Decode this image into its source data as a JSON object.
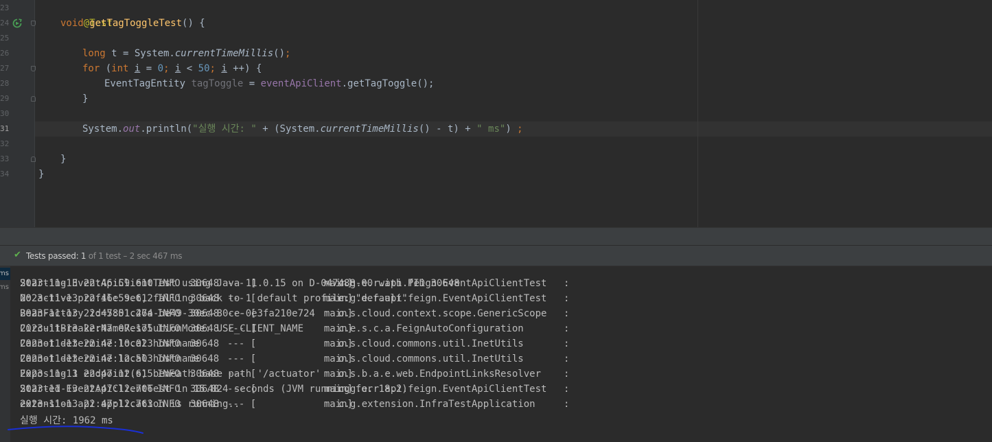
{
  "editor": {
    "line_numbers": [
      "23",
      "24",
      "25",
      "26",
      "27",
      "28",
      "29",
      "30",
      "31",
      "32",
      "33",
      "34"
    ],
    "current_line": "31",
    "lines": {
      "l23": {
        "annotation": "@Test"
      },
      "l24": {
        "kw_void": "void",
        "method": "getTagToggleTest",
        "rest": "() {"
      },
      "l26": {
        "kw_long": "long",
        "decl": " t = System.",
        "call": "currentTimeMillis",
        "parens": "()",
        "semi": ";"
      },
      "l27": {
        "kw_for": "for",
        "p1": " (",
        "kw_int": "int",
        "sp": " ",
        "var1": "i",
        "eq": " = ",
        "zero": "0",
        "semi1": "; ",
        "var2": "i",
        "lt": " < ",
        "fifty": "50",
        "semi2": "; ",
        "var3": "i",
        "inc": " ++) {"
      },
      "l28": {
        "type": "EventTagEntity",
        "sp": " ",
        "local": "tagToggle",
        "eq": " = ",
        "client": "eventApiClient",
        "call": ".getTagToggle();"
      },
      "l29": {
        "brace": "}"
      },
      "l31": {
        "sys": "System.",
        "out": "out",
        "println": ".println(",
        "str1": "\"실행 시간: \"",
        "plus1": " + (System.",
        "ctm": "currentTimeMillis",
        "minus": "() - t) + ",
        "str2": "\" ms\"",
        "close": ") ",
        "semi": ";"
      },
      "l33": {
        "brace": "}"
      },
      "l34": {
        "brace": "}"
      }
    }
  },
  "test_status": {
    "check_icon": "check-icon",
    "passed_label": "Tests passed:",
    "passed_count": "1",
    "rest": "of 1 test – 2 sec 467 ms"
  },
  "side_tabs": [
    "ms",
    "ms"
  ],
  "console": {
    "log_lines": [
      {
        "date": "2023-11-13 22:46:59.610",
        "level": "INFO",
        "pid": "30648",
        "sep": "--- [",
        "thread": "main]",
        "logger": "c.g.e.r.api.feign.EventApiClientTest",
        "colon": ":",
        "message": "Starting EventApiClientTest using Java 11.0.15 on D-047488-00 with PID 30648"
      },
      {
        "date": "2023-11-13 22:46:59.612",
        "level": "INFO",
        "pid": "30648",
        "sep": "--- [",
        "thread": "main]",
        "logger": "c.g.e.r.api.feign.EventApiClientTest",
        "colon": ":",
        "message": "No active profile set, falling back to 1 default profile: \"default\""
      },
      {
        "date": "2023-11-13 22:47:01.274",
        "level": "INFO",
        "pid": "30648",
        "sep": "--- [",
        "thread": "main]",
        "logger": "o.s.cloud.context.scope.GenericScope",
        "colon": ":",
        "message": "BeanFactory id=5851c46a-be49-30ec-80ce-0e3fa210e724"
      },
      {
        "date": "2023-11-13 22:47:07.175",
        "level": "INFO",
        "pid": "30648",
        "sep": "--- [",
        "thread": "main]",
        "logger": "c.e.s.c.a.FeignAutoConfiguration",
        "colon": ":",
        "message": "CircuitBreakerNameResolutionMode: USE_CLIENT_NAME"
      },
      {
        "date": "2023-11-13 22:47:10.023",
        "level": "INFO",
        "pid": "30648",
        "sep": "--- [",
        "thread": "main]",
        "logger": "o.s.cloud.commons.util.InetUtils",
        "colon": ":",
        "message": "Cannot determine local hostname"
      },
      {
        "date": "2023-11-13 22:47:12.503",
        "level": "INFO",
        "pid": "30648",
        "sep": "--- [",
        "thread": "main]",
        "logger": "o.s.cloud.commons.util.InetUtils",
        "colon": ":",
        "message": "Cannot determine local hostname"
      },
      {
        "date": "2023-11-13 22:47:12.615",
        "level": "INFO",
        "pid": "30648",
        "sep": "--- [",
        "thread": "main]",
        "logger": "o.s.b.a.e.web.EndpointLinksResolver",
        "colon": ":",
        "message": "Exposing 1 endpoint(s) beneath base path '/actuator'"
      },
      {
        "date": "2023-11-13 22:47:12.706",
        "level": "INFO",
        "pid": "30648",
        "sep": "--- [",
        "thread": "main]",
        "logger": "c.g.e.r.api.feign.EventApiClientTest",
        "colon": ":",
        "message": "Started EventApiClientTest in 15.824 seconds (JVM running for 18.2)"
      },
      {
        "date": "2023-11-13 22:47:12.763",
        "level": "INFO",
        "pid": "30648",
        "sep": "--- [",
        "thread": "main]",
        "logger": "c.g.extension.InfraTestApplication",
        "colon": ":",
        "message": "extension api application is running.."
      }
    ],
    "result_line": "실행 시간: 1962 ms"
  },
  "colors": {
    "background": "#2b2b2b",
    "keyword": "#cc7832",
    "method": "#ffc66d",
    "number": "#6897bb",
    "string": "#6a8759",
    "annotation": "#bbb529",
    "success": "#5fb24e",
    "underline_scribble": "#1a2fd6"
  }
}
